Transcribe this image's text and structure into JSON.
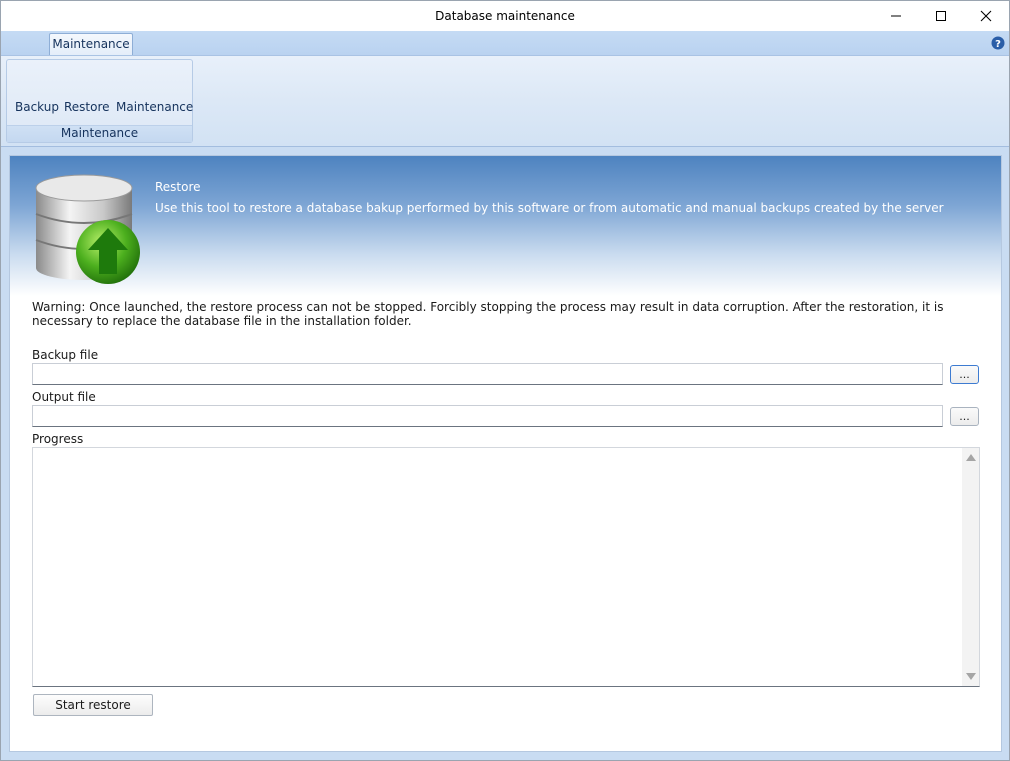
{
  "window": {
    "title": "Database maintenance"
  },
  "ribbon": {
    "tab_label": "Maintenance",
    "group_label": "Maintenance",
    "buttons": [
      {
        "label": "Backup"
      },
      {
        "label": "Restore"
      },
      {
        "label": "Maintenance"
      }
    ]
  },
  "banner": {
    "title": "Restore",
    "description": "Use this tool to restore a database bakup performed by this software or from automatic and manual backups created by the server"
  },
  "warning": "Warning: Once launched, the restore process can not be stopped. Forcibly stopping the process may result in data corruption. After the restoration, it is necessary to replace the database file in the installation folder.",
  "form": {
    "backup_file_label": "Backup file",
    "backup_file_value": "",
    "output_file_label": "Output file",
    "output_file_value": "",
    "browse_label": "...",
    "progress_label": "Progress",
    "start_button_label": "Start restore"
  },
  "colors": {
    "accent": "#3d7bd1",
    "ribbon_text": "#15325c",
    "banner_top": "#4e83c0",
    "arrow_green": "#4caf1e"
  },
  "icons": {
    "minimize": "minimize-icon",
    "maximize": "maximize-icon",
    "close": "close-icon",
    "help": "help-icon",
    "database": "database-restore-icon"
  }
}
